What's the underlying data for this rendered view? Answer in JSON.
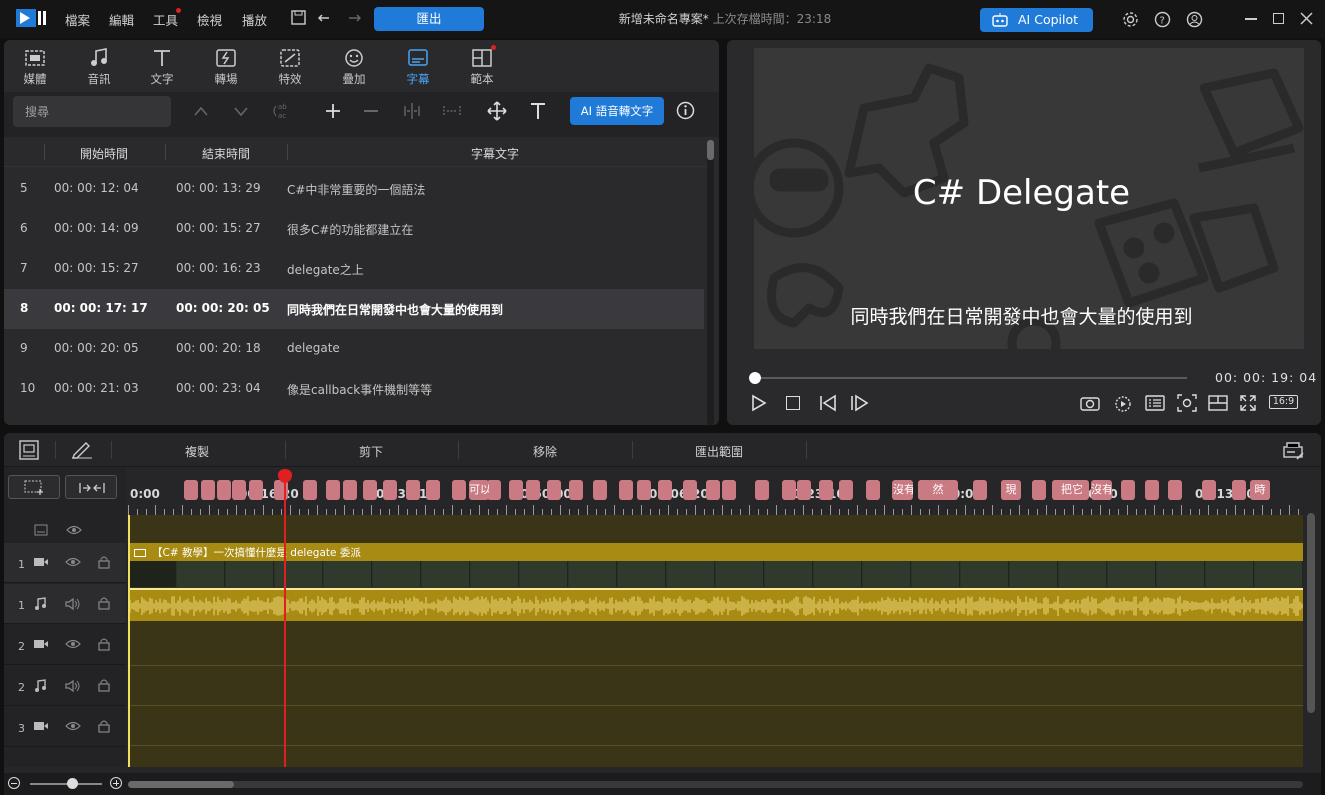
{
  "menu": {
    "file": "檔案",
    "edit": "編輯",
    "tools": "工具",
    "view": "檢視",
    "play": "播放",
    "export": "匯出"
  },
  "title": {
    "project": "新增未命名專案*",
    "last_saved": "上次存檔時間：23:18"
  },
  "copilot": "AI Copilot",
  "tabs": [
    {
      "label": "媒體",
      "icon": "media-icon"
    },
    {
      "label": "音訊",
      "icon": "music-icon"
    },
    {
      "label": "文字",
      "icon": "text-icon"
    },
    {
      "label": "轉場",
      "icon": "transition-icon"
    },
    {
      "label": "特效",
      "icon": "effects-icon"
    },
    {
      "label": "疊加",
      "icon": "overlay-icon"
    },
    {
      "label": "字幕",
      "icon": "subtitle-icon",
      "active": true
    },
    {
      "label": "範本",
      "icon": "template-icon"
    }
  ],
  "subtitle_toolbar": {
    "search_placeholder": "搜尋",
    "ai_button": "AI 語音轉文字"
  },
  "table": {
    "headers": [
      "開始時間",
      "結束時間",
      "字幕文字"
    ],
    "rows": [
      {
        "index": "5",
        "start": "00: 00: 12: 04",
        "end": "00: 00: 13: 29",
        "text": "C#中非常重要的一個語法"
      },
      {
        "index": "6",
        "start": "00: 00: 14: 09",
        "end": "00: 00: 15: 27",
        "text": "很多C#的功能都建立在"
      },
      {
        "index": "7",
        "start": "00: 00: 15: 27",
        "end": "00: 00: 16: 23",
        "text": "delegate之上"
      },
      {
        "index": "8",
        "start": "00: 00: 17: 17",
        "end": "00: 00: 20: 05",
        "text": "同時我們在日常開發中也會大量的使用到",
        "selected": true
      },
      {
        "index": "9",
        "start": "00: 00: 20: 05",
        "end": "00: 00: 20: 18",
        "text": "delegate"
      },
      {
        "index": "10",
        "start": "00: 00: 21: 03",
        "end": "00: 00: 23: 04",
        "text": "像是callback事件機制等等"
      }
    ]
  },
  "preview": {
    "title": "C# Delegate",
    "subtitle": "同時我們在日常開發中也會大量的使用到",
    "current_time": "00: 00: 19: 04",
    "aspect_ratio": "16:9",
    "progress_fraction": 0.0
  },
  "timeline_toolbar": {
    "copy": "複製",
    "cut": "剪下",
    "remove": "移除",
    "export_range": "匯出範圍"
  },
  "ruler_ticks": [
    "0:00",
    "00:16:20",
    "00:33:10",
    "00:50:00",
    "01:06:20",
    "01:23:10",
    "01:40:00",
    "01:56:20",
    "02:13:10"
  ],
  "subtitle_clip_labels": [
    "可以",
    "沒有",
    "然",
    "現",
    "把它",
    "沒有",
    "時"
  ],
  "tracks": [
    {
      "num": "1",
      "type": "video-icon"
    },
    {
      "num": "1",
      "type": "audio-icon"
    },
    {
      "num": "2",
      "type": "video-icon"
    },
    {
      "num": "2",
      "type": "audio-icon"
    },
    {
      "num": "3",
      "type": "video-icon"
    }
  ],
  "video_clip_label": "【C# 教學】一次搞懂什麼是 delegate 委派",
  "colors": {
    "accent": "#1f7ad8",
    "subtitle_clip": "#c97a82",
    "media_clip": "#a88b13",
    "playhead": "#e02020"
  }
}
